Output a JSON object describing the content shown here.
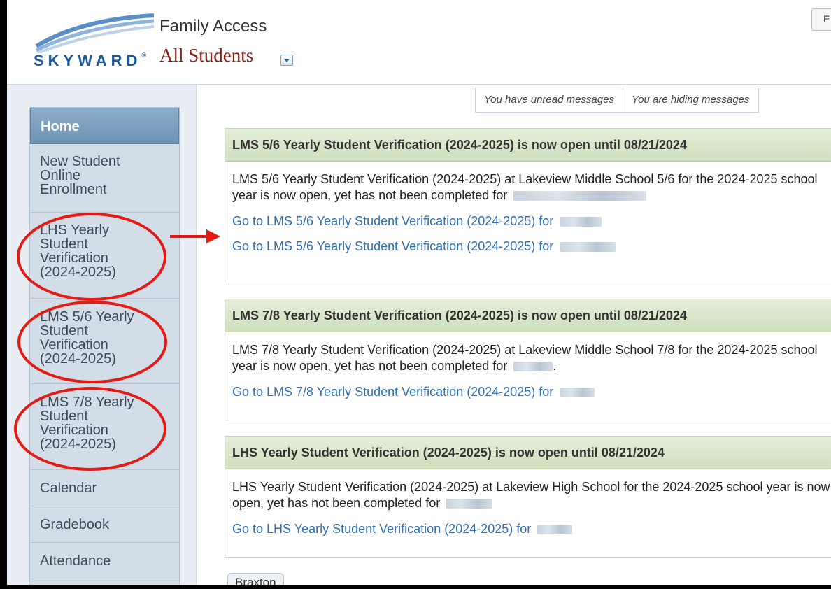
{
  "header": {
    "logo_text": "SKYWARD",
    "logo_mark": "®",
    "app_title": "Family Access",
    "student_selector": "All Students",
    "top_right_button": "E"
  },
  "sidebar": {
    "items": [
      {
        "label": "Home"
      },
      {
        "label_lines": [
          "New Student",
          "Online",
          "Enrollment"
        ]
      },
      {
        "label_lines": [
          "LHS Yearly",
          "Student",
          "Verification",
          "(2024-2025)"
        ]
      },
      {
        "label_lines": [
          "LMS 5/6 Yearly",
          "Student",
          "Verification",
          "(2024-2025)"
        ]
      },
      {
        "label_lines": [
          "LMS 7/8 Yearly",
          "Student",
          "Verification",
          "(2024-2025)"
        ]
      },
      {
        "label": "Calendar"
      },
      {
        "label": "Gradebook"
      },
      {
        "label": "Attendance"
      }
    ]
  },
  "messages": {
    "unread": "You have unread messages",
    "hiding": "You are hiding messages"
  },
  "cards": [
    {
      "title": "LMS 5/6 Yearly Student Verification (2024-2025) is now open until 08/21/2024",
      "description": "LMS 5/6 Yearly Student Verification (2024-2025) at Lakeview Middle School 5/6 for the 2024-2025 school year is now open, yet has not been completed for",
      "links": [
        "Go to LMS 5/6 Yearly Student Verification (2024-2025) for",
        "Go to LMS 5/6 Yearly Student Verification (2024-2025) for"
      ]
    },
    {
      "title": "LMS 7/8 Yearly Student Verification (2024-2025) is now open until 08/21/2024",
      "description": "LMS 7/8 Yearly Student Verification (2024-2025) at Lakeview Middle School 7/8 for the 2024-2025 school year is now open, yet has not been completed for",
      "description_suffix": ".",
      "links": [
        "Go to LMS 7/8 Yearly Student Verification (2024-2025) for"
      ]
    },
    {
      "title": "LHS Yearly Student Verification (2024-2025) is now open until 08/21/2024",
      "description": "LHS Yearly Student Verification (2024-2025) at Lakeview High School for the 2024-2025 school year is now open, yet has not been completed for",
      "links": [
        "Go to LHS Yearly Student Verification (2024-2025) for"
      ]
    }
  ],
  "student_tab": "Braxton",
  "colors": {
    "annotation_red": "#e51a14",
    "link_blue": "#2f6fb3",
    "header_green": "#cfdfbe",
    "student_red": "#8b1c13"
  }
}
